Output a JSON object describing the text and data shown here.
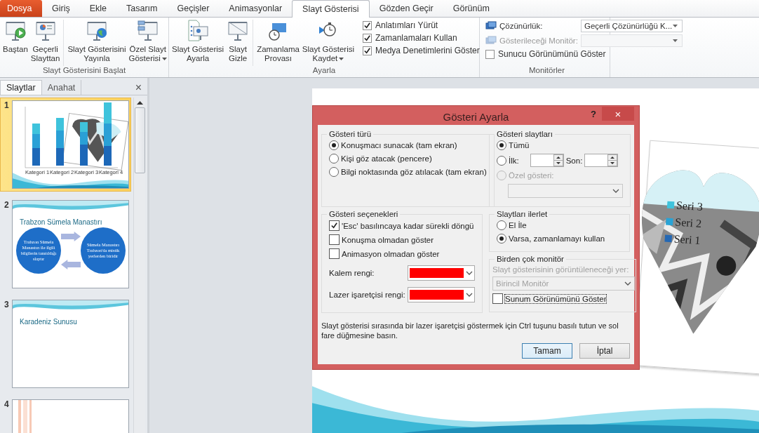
{
  "ribbon_tabs": [
    {
      "label": "Dosya",
      "kind": "file",
      "selected": false
    },
    {
      "label": "Giriş",
      "kind": "tab",
      "selected": false
    },
    {
      "label": "Ekle",
      "kind": "tab",
      "selected": false
    },
    {
      "label": "Tasarım",
      "kind": "tab",
      "selected": false
    },
    {
      "label": "Geçişler",
      "kind": "tab",
      "selected": false
    },
    {
      "label": "Animasyonlar",
      "kind": "tab",
      "selected": false
    },
    {
      "label": "Slayt Gösterisi",
      "kind": "tab",
      "selected": true
    },
    {
      "label": "Gözden Geçir",
      "kind": "tab",
      "selected": false
    },
    {
      "label": "Görünüm",
      "kind": "tab",
      "selected": false
    }
  ],
  "ribbon_groups": [
    {
      "title": "Slayt Gösterisini Başlat",
      "buttons": [
        {
          "lines": [
            "Baştan"
          ],
          "dropdown": false,
          "separator_before": false
        },
        {
          "lines": [
            "Geçerli",
            "Slayttan"
          ],
          "dropdown": false,
          "separator_before": false
        },
        {
          "lines": [
            "Slayt Gösterisini",
            "Yayınla"
          ],
          "dropdown": false,
          "separator_before": true
        },
        {
          "lines": [
            "Özel Slayt",
            "Gösterisi"
          ],
          "dropdown": true,
          "separator_before": false
        }
      ]
    },
    {
      "title": "Ayarla",
      "buttons": [
        {
          "lines": [
            "Slayt Gösterisi",
            "Ayarla"
          ],
          "dropdown": false,
          "separator_before": false
        },
        {
          "lines": [
            "Slayt",
            "Gizle"
          ],
          "dropdown": false,
          "separator_before": false
        },
        {
          "lines": [
            "Zamanlama",
            "Provası"
          ],
          "dropdown": false,
          "separator_before": true
        },
        {
          "lines": [
            "Slayt Gösterisi",
            "Kaydet"
          ],
          "dropdown": true,
          "separator_before": false
        }
      ],
      "checkboxes": [
        {
          "label": "Anlatımları Yürüt",
          "checked": true
        },
        {
          "label": "Zamanlamaları Kullan",
          "checked": true
        },
        {
          "label": "Medya Denetimlerini Göster",
          "checked": true
        }
      ]
    },
    {
      "title": "Monitörler",
      "fields": [
        {
          "label": "Çözünürlük:",
          "value": "Geçerli Çözünürlüğü K...",
          "disabled": false
        },
        {
          "label": "Gösterileceği Monitör:",
          "disabled": true
        }
      ],
      "checkboxes": [
        {
          "label": "Sunucu Görünümünü Göster",
          "checked": false
        }
      ]
    }
  ],
  "slides_panel": {
    "tabs": [
      {
        "label": "Slaytlar",
        "selected": true
      },
      {
        "label": "Anahat",
        "selected": false
      }
    ],
    "close": "×",
    "slides": [
      {
        "number": "1",
        "kind": "chart",
        "selected": true,
        "categories": [
          "Kategori 1",
          "Kategori 2",
          "Kategori 3",
          "Kategori 4"
        ]
      },
      {
        "number": "2",
        "kind": "diagram",
        "selected": false,
        "title": "Trabzon Sümela Manastırı",
        "circles": [
          "Trabzon Sümela Manastırı ile ilgili bilgilerin tanıtıldığı slaytır",
          "Sümela Manastırı Trabzon'da mistik yerlerden biridir"
        ]
      },
      {
        "number": "3",
        "kind": "title",
        "selected": false,
        "title": "Karadeniz Sunusu"
      },
      {
        "number": "4",
        "kind": "stripes",
        "selected": false
      }
    ]
  },
  "slide": {
    "legend": [
      {
        "label": "Seri 3",
        "color": "#3fc3dc"
      },
      {
        "label": "Seri 2",
        "color": "#28a3d6"
      },
      {
        "label": "Seri 1",
        "color": "#2468b4"
      }
    ]
  },
  "dialog": {
    "title": "Gösteri Ayarla",
    "help": "?",
    "close": "×",
    "show_type": {
      "title": "Gösteri türü",
      "options": [
        {
          "label": "Konuşmacı sunacak (tam ekran)",
          "selected": true
        },
        {
          "label": "Kişi göz atacak (pencere)",
          "selected": false
        },
        {
          "label": "Bilgi noktasında göz atılacak (tam ekran)",
          "selected": false
        }
      ]
    },
    "show_slides": {
      "title": "Gösteri slaytları",
      "all": {
        "label": "Tümü",
        "selected": true
      },
      "range": {
        "label": "İlk:",
        "selected": false,
        "to_label": "Son:"
      },
      "custom": {
        "label": "Özel gösteri:",
        "selected": false,
        "disabled": true
      }
    },
    "show_options": {
      "title": "Gösteri seçenekleri",
      "checkboxes": [
        {
          "label": "'Esc' basılıncaya kadar sürekli döngü",
          "checked": true
        },
        {
          "label": "Konuşma olmadan göster",
          "checked": false
        },
        {
          "label": "Animasyon olmadan göster",
          "checked": false
        }
      ],
      "colors": [
        {
          "label": "Kalem rengi:",
          "color": "#ff0000"
        },
        {
          "label": "Lazer işaretçisi rengi:",
          "color": "#ff0000"
        }
      ]
    },
    "advance": {
      "title": "Slaytları ilerlet",
      "options": [
        {
          "label": "El İle",
          "selected": false
        },
        {
          "label": "Varsa, zamanlamayı kullan",
          "selected": true
        }
      ]
    },
    "monitors": {
      "title": "Birden çok monitör",
      "label": "Slayt gösterisinin görüntüleneceği yer:",
      "value": "Birincil Monitör",
      "disabled": true,
      "checkbox": {
        "label": "Sunum Görünümünü Göster",
        "checked": false,
        "focused": true
      }
    },
    "hint": "Slayt gösterisi sırasında bir lazer işaretçisi göstermek için Ctrl tuşunu basılı tutun ve sol fare düğmesine basın.",
    "buttons": [
      {
        "label": "Tamam",
        "default": true
      },
      {
        "label": "İptal",
        "default": false
      }
    ]
  }
}
